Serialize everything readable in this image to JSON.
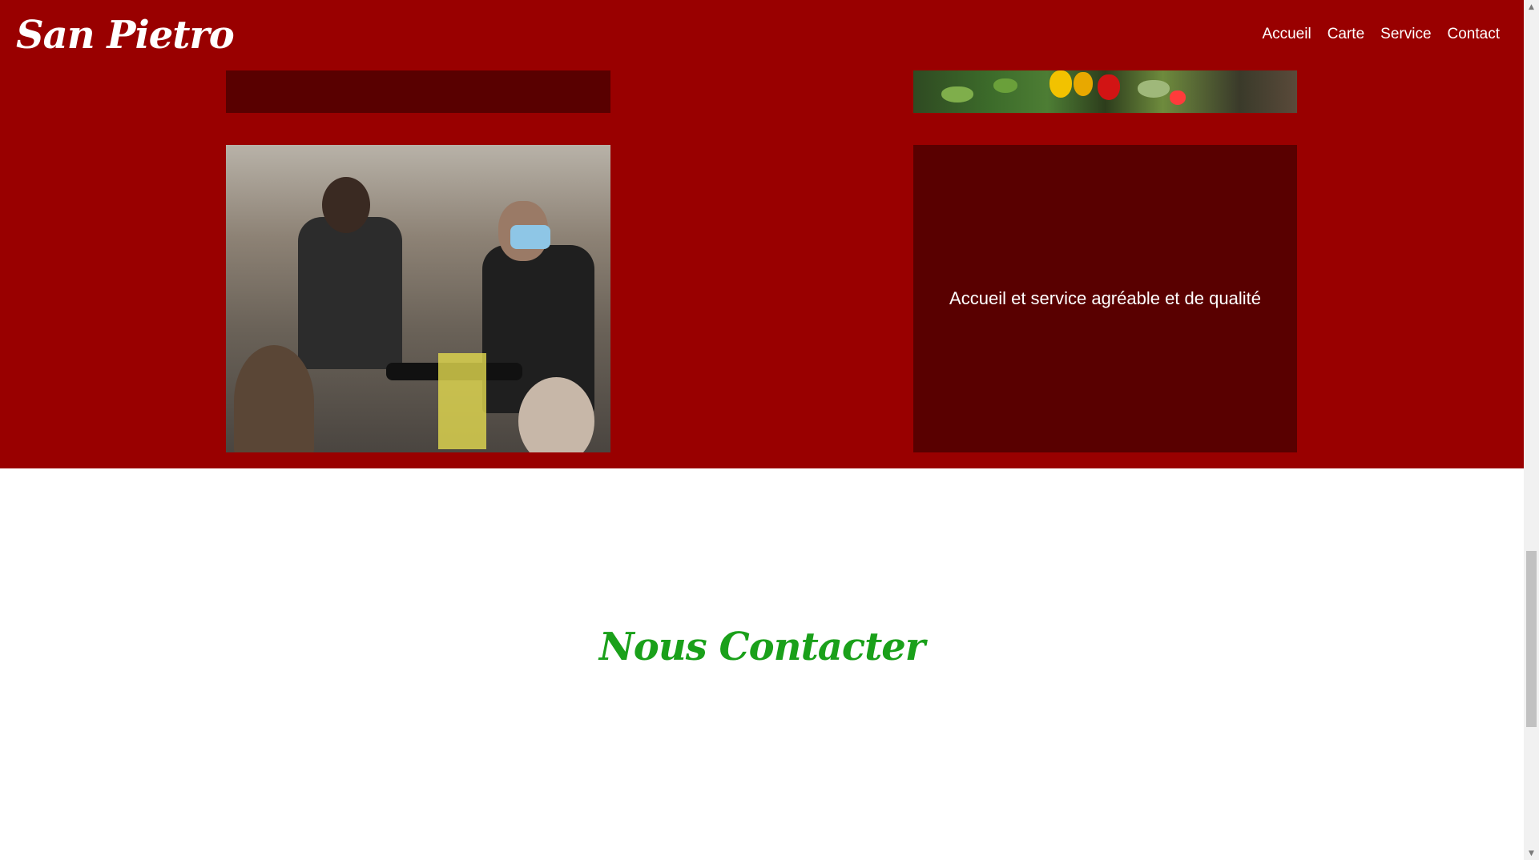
{
  "header": {
    "brand": "San Pietro",
    "nav": [
      "Accueil",
      "Carte",
      "Service",
      "Contact"
    ]
  },
  "services": {
    "card_text": "Accueil et service agréable et de qualité"
  },
  "contact": {
    "title": "Nous Contacter"
  },
  "colors": {
    "primary_red": "#990000",
    "dark_red": "#590000",
    "green_title": "#1aa01a"
  },
  "icons": {
    "scroll_up": "▲",
    "scroll_down": "▼"
  }
}
